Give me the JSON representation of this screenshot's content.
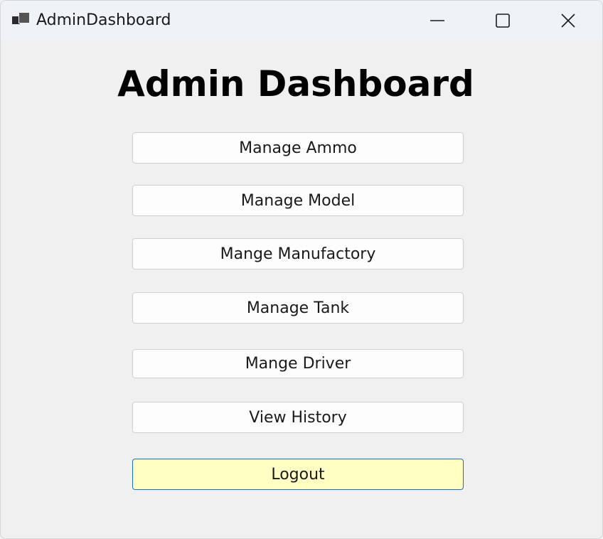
{
  "window": {
    "title": "AdminDashboard",
    "app_icon": "app-window-icon",
    "controls": {
      "minimize_icon": "minimize-icon",
      "maximize_icon": "maximize-icon",
      "close_icon": "close-icon"
    }
  },
  "main": {
    "heading": "Admin Dashboard",
    "buttons": [
      {
        "label": "Manage Ammo"
      },
      {
        "label": "Manage Model"
      },
      {
        "label": "Mange Manufactory"
      },
      {
        "label": "Manage Tank"
      },
      {
        "label": "Mange Driver"
      },
      {
        "label": "View History"
      },
      {
        "label": "Logout"
      }
    ]
  },
  "colors": {
    "window_bg": "#f0f0f0",
    "titlebar_bg": "#eff3f8",
    "logout_bg": "#ffffc4",
    "logout_border": "#1a6fc9"
  }
}
